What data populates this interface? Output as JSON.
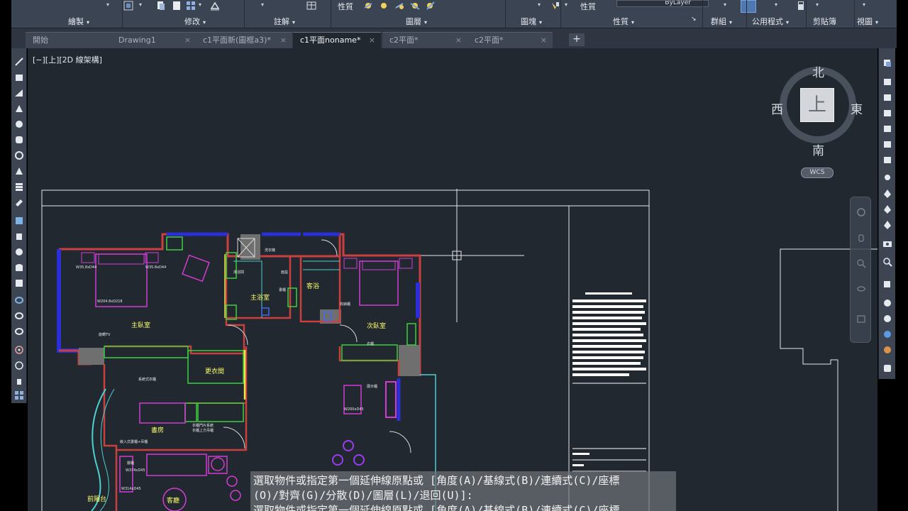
{
  "ribbon": {
    "panels": [
      {
        "label": "繪製",
        "caret": "▾"
      },
      {
        "label": "修改",
        "caret": "▾"
      },
      {
        "label": "註解",
        "caret": "▾"
      },
      {
        "label": "圖層",
        "caret": "▾"
      },
      {
        "label": "圖塊",
        "caret": "▾"
      },
      {
        "label": "性質",
        "caret": "▾"
      },
      {
        "label": "群組",
        "caret": "▾"
      },
      {
        "label": "公用程式",
        "caret": "▾"
      },
      {
        "label": "剪貼簿",
        "caret": ""
      },
      {
        "label": "視圖",
        "caret": "▾"
      }
    ],
    "props_text_1": "性質",
    "props_text_2": "性質",
    "bylayer": "ByLayer",
    "dialog_launcher": "↘"
  },
  "tabs": [
    {
      "label": "開始",
      "close": ""
    },
    {
      "label": "Drawing1",
      "close": "×"
    },
    {
      "label": "c1平面新(圖框a3)*",
      "close": "×"
    },
    {
      "label": "c1平面noname*",
      "close": "×"
    },
    {
      "label": "c2平面*",
      "close": "×"
    },
    {
      "label": "c2平面*",
      "close": "×"
    }
  ],
  "tab_add": "+",
  "viewport_label": "[−][上][2D 線架構]",
  "viewcube": {
    "north": "北",
    "south": "南",
    "east": "東",
    "west": "西",
    "face": "上"
  },
  "wcs": "WCS",
  "drawing": {
    "rooms": [
      "主臥室",
      "主浴室",
      "客浴",
      "次臥室",
      "更衣間",
      "書房",
      "客廳",
      "前陽台"
    ],
    "small_labels": [
      "W35.8xD44",
      "W35.8xD44",
      "W204.8xD218",
      "旋轉TV",
      "書櫃",
      "淋浴間",
      "面盆",
      "洗衣機",
      "收納櫃",
      "移門",
      "衣櫃",
      "系統式衣櫃",
      "衣櫃門片系統",
      "衣櫃上方吊櫃",
      "收納式書櫃",
      "嵌入式書櫃+吊櫃",
      "層櫃",
      "W374xD45",
      "W314xD45",
      "雙開門",
      "展示櫃",
      "W200xD45"
    ],
    "title_block_lines": [
      "",
      "",
      "",
      "",
      "",
      "",
      "",
      "",
      "",
      "",
      "",
      "",
      "",
      "",
      "",
      "",
      ""
    ]
  },
  "command": {
    "line1": "選取物件或指定第一個延伸線原點或 [角度(A)/基線式(B)/連續式(C)/座標",
    "line2": "(O)/對齊(G)/分散(D)/圖層(L)/退回(U)]:",
    "line3": "選取物件或指定第一個延伸線原點或 [角度(A)/基線式(B)/連續式(C)/座標"
  }
}
